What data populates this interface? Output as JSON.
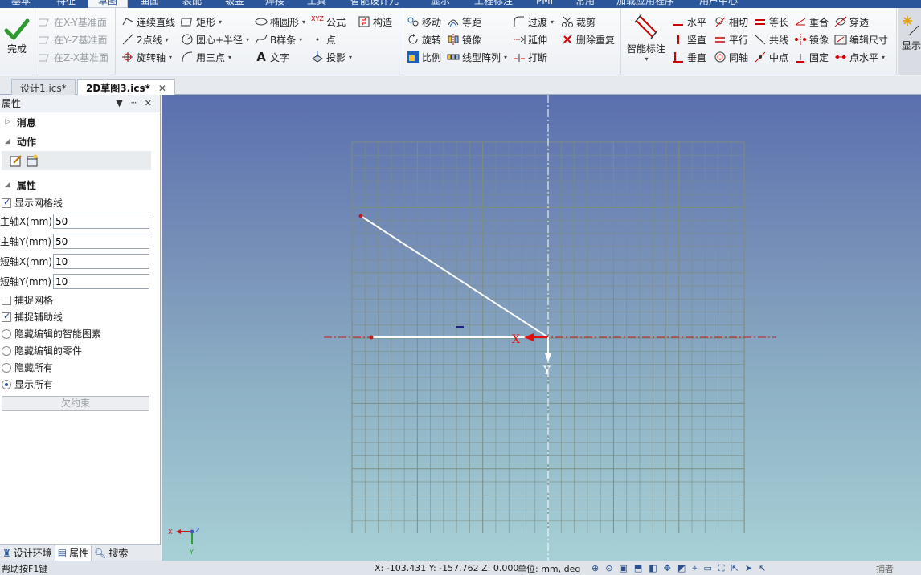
{
  "menu_tabs": [
    {
      "label": "基本",
      "active": false
    },
    {
      "label": "特征",
      "active": false
    },
    {
      "label": "草图",
      "active": true
    },
    {
      "label": "曲面",
      "active": false
    },
    {
      "label": "装配",
      "active": false
    },
    {
      "label": "钣金",
      "active": false
    },
    {
      "label": "焊接",
      "active": false
    },
    {
      "label": "工具",
      "active": false
    },
    {
      "label": "智能设计元",
      "active": false
    },
    {
      "label": "显示",
      "active": false
    },
    {
      "label": "工程标注",
      "active": false
    },
    {
      "label": "PMI",
      "active": false
    },
    {
      "label": "常用",
      "active": false
    },
    {
      "label": "加载应用程序",
      "active": false
    },
    {
      "label": "用户中心",
      "active": false
    }
  ],
  "ribbon": {
    "finish": "完成",
    "datum": [
      "在X-Y基准面",
      "在Y-Z基准面",
      "在Z-X基准面"
    ],
    "draw_col1": [
      "连续直线",
      "2点线",
      "旋转轴"
    ],
    "draw_col2": [
      "矩形",
      "圆心+半径",
      "用三点"
    ],
    "draw_col3": [
      "椭圆形",
      "B样条",
      "文字"
    ],
    "draw_col4": [
      "公式",
      "点",
      "投影"
    ],
    "construct": "构造",
    "edit_col1": [
      "移动",
      "旋转",
      "比例"
    ],
    "edit_col2": [
      "等距",
      "镜像",
      "线型阵列"
    ],
    "edit_col3": [
      "过渡",
      "延伸",
      "打断"
    ],
    "edit_col4": [
      "裁剪",
      "删除重复"
    ],
    "smart_dim": "智能标注",
    "cons_col1": [
      "水平",
      "竖直",
      "垂直"
    ],
    "cons_col2": [
      "相切",
      "平行",
      "同轴"
    ],
    "cons_col3": [
      "等长",
      "共线",
      "中点"
    ],
    "cons_col4": [
      "重合",
      "镜像",
      "固定"
    ],
    "cons_col5": [
      "穿透",
      "编辑尺寸",
      "点水平"
    ],
    "show": "显示"
  },
  "doc_tabs": [
    {
      "label": "设计1.ics*",
      "active": false
    },
    {
      "label": "2D草图3.ics*",
      "active": true
    }
  ],
  "panel": {
    "title": "属性",
    "sections": {
      "messages": "消息",
      "actions": "动作",
      "properties": "属性"
    },
    "show_grid": "显示网格线",
    "fields": [
      {
        "label": "主轴X(mm)",
        "value": "50"
      },
      {
        "label": "主轴Y(mm)",
        "value": "50"
      },
      {
        "label": "短轴X(mm)",
        "value": "10"
      },
      {
        "label": "短轴Y(mm)",
        "value": "10"
      }
    ],
    "snap_grid": "捕捉网格",
    "snap_aux": "捕捉辅助线",
    "radios": [
      {
        "label": "隐藏编辑的智能图素",
        "on": false
      },
      {
        "label": "隐藏编辑的零件",
        "on": false
      },
      {
        "label": "隐藏所有",
        "on": false
      },
      {
        "label": "显示所有",
        "on": true
      }
    ],
    "underconstrained_button": "欠约束",
    "bottom_tabs": [
      "设计环境",
      "属性",
      "搜索"
    ]
  },
  "canvas": {
    "x_label": "X",
    "y_label": "Y",
    "triad": {
      "x": "X",
      "y": "Y",
      "z": "Z"
    },
    "colors": {
      "grid": "#7d8d82",
      "axis_h": "#c21b1b",
      "axis_v": "#ffffff",
      "sketch": "#ffffff",
      "x_arrow": "#e01010"
    }
  },
  "status": {
    "help": "帮助按F1键",
    "coords": "X: -103.431 Y: -157.762 Z: 0.000",
    "units": "单位: mm, deg",
    "snap": "捕者"
  }
}
